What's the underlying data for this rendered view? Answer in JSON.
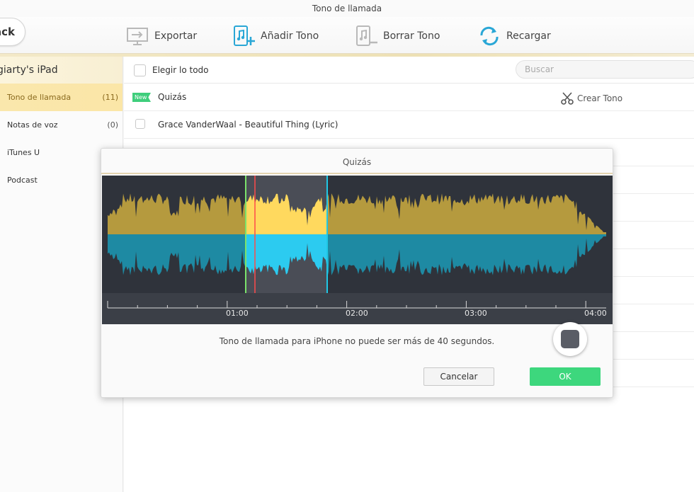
{
  "window": {
    "title": "Tono de llamada"
  },
  "toolbar": {
    "back_label": "ack",
    "export_label": "Exportar",
    "add_label": "Añadir Tono",
    "delete_label": "Borrar Tono",
    "reload_label": "Recargar"
  },
  "sidebar": {
    "device_name": "giarty's iPad",
    "items": [
      {
        "label": "Tono de llamada",
        "count": "(11)"
      },
      {
        "label": "Notas de voz",
        "count": "(0)"
      },
      {
        "label": "iTunes U",
        "count": ""
      },
      {
        "label": "Podcast",
        "count": ""
      }
    ]
  },
  "list": {
    "select_all_label": "Elegir lo todo",
    "search_placeholder": "Buscar",
    "new_badge": "New",
    "create_tone_label": "Crear Tono",
    "rows": [
      {
        "title": "Quizás"
      },
      {
        "title": "Grace VanderWaal - Beautiful Thing (Lyric)"
      }
    ]
  },
  "dialog": {
    "title": "Quizás",
    "timeline_labels": [
      "01:00",
      "02:00",
      "03:00",
      "04:00"
    ],
    "message": "Tono de llamada para iPhone no puede ser más de 40 segundos.",
    "cancel_label": "Cancelar",
    "ok_label": "OK",
    "colors": {
      "wave_top": "#b59a3e",
      "wave_top_selected": "#ffd95e",
      "wave_bottom": "#1e8aa3",
      "wave_bottom_selected": "#2ccbf0",
      "start_marker": "#7be36b",
      "playhead": "#ff4a4a",
      "end_marker": "#1fc8e6",
      "ok_button": "#3dd77d"
    }
  }
}
